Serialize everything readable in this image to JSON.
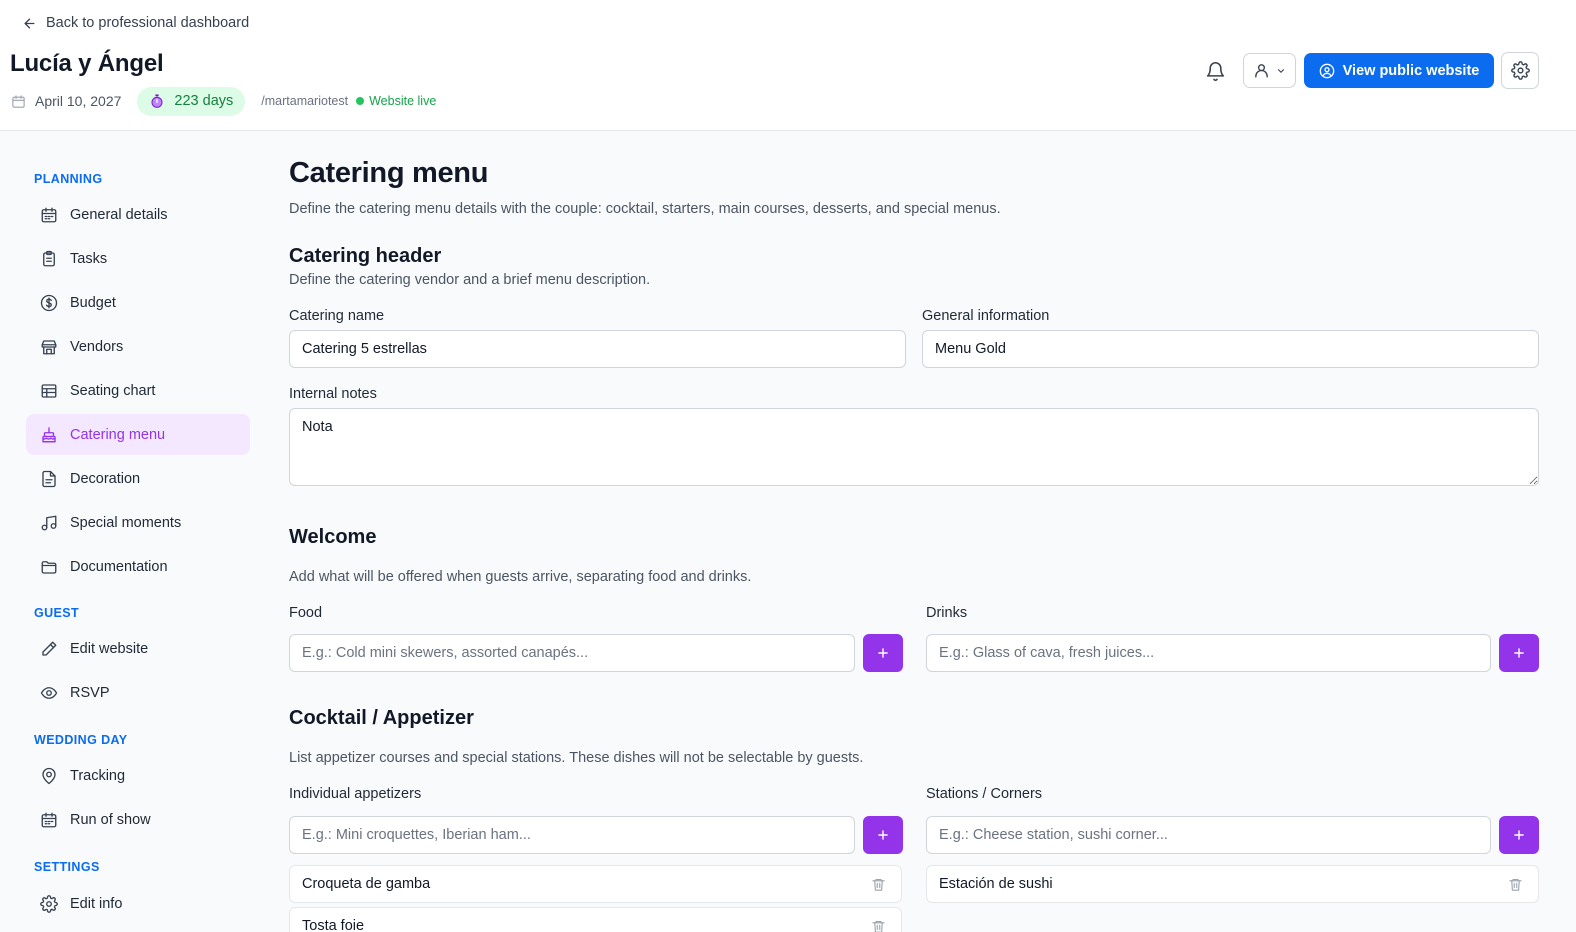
{
  "header": {
    "back_label": "Back to professional dashboard",
    "couple_name": "Lucía y Ángel",
    "wedding_date": "April 10, 2027",
    "days_left": "223 days",
    "slug": "/martamariotest",
    "status": "Website live",
    "public_button": "View public website"
  },
  "sidebar": {
    "sections": {
      "planning": "PLANNING",
      "guest": "GUEST",
      "wedding_day": "WEDDING DAY",
      "settings": "SETTINGS"
    },
    "items": [
      {
        "label": "General details",
        "icon": "calendar-icon"
      },
      {
        "label": "Tasks",
        "icon": "clipboard-icon"
      },
      {
        "label": "Budget",
        "icon": "dollar-icon"
      },
      {
        "label": "Vendors",
        "icon": "store-icon"
      },
      {
        "label": "Seating chart",
        "icon": "table-icon"
      },
      {
        "label": "Catering menu",
        "icon": "cake-icon",
        "active": true
      },
      {
        "label": "Decoration",
        "icon": "file-icon"
      },
      {
        "label": "Special moments",
        "icon": "music-icon"
      },
      {
        "label": "Documentation",
        "icon": "folder-icon"
      },
      {
        "label": "Edit website",
        "icon": "pencil-icon"
      },
      {
        "label": "RSVP",
        "icon": "eye-icon"
      },
      {
        "label": "Tracking",
        "icon": "map-pin-icon"
      },
      {
        "label": "Run of show",
        "icon": "calendar-icon"
      },
      {
        "label": "Edit info",
        "icon": "gear-icon"
      }
    ]
  },
  "main": {
    "title": "Catering menu",
    "subtitle": "Define the catering menu details with the couple: cocktail, starters, main courses, desserts, and special menus.",
    "header_section": {
      "title": "Catering header",
      "subtitle": "Define the catering vendor and a brief menu description.",
      "catering_name_label": "Catering name",
      "catering_name_value": "Catering 5 estrellas",
      "general_info_label": "General information",
      "general_info_value": "Menu Gold",
      "notes_label": "Internal notes",
      "notes_value": "Nota"
    },
    "welcome": {
      "title": "Welcome",
      "subtitle": "Add what will be offered when guests arrive, separating food and drinks.",
      "food_label": "Food",
      "food_placeholder": "E.g.: Cold mini skewers, assorted canapés...",
      "drinks_label": "Drinks",
      "drinks_placeholder": "E.g.: Glass of cava, fresh juices..."
    },
    "cocktail": {
      "title": "Cocktail / Appetizer",
      "subtitle": "List appetizer courses and special stations. These dishes will not be selectable by guests.",
      "individual_label": "Individual appetizers",
      "individual_placeholder": "E.g.: Mini croquettes, Iberian ham...",
      "individual_items": [
        "Croqueta de gamba",
        "Tosta foie"
      ],
      "stations_label": "Stations / Corners",
      "stations_placeholder": "E.g.: Cheese station, sushi corner...",
      "stations_items": [
        "Estación de sushi"
      ]
    }
  },
  "colors": {
    "primary_blue": "#0b6cf0",
    "accent_purple": "#9333ea",
    "active_bg": "#f3e8ff",
    "live_green": "#16a34a"
  }
}
